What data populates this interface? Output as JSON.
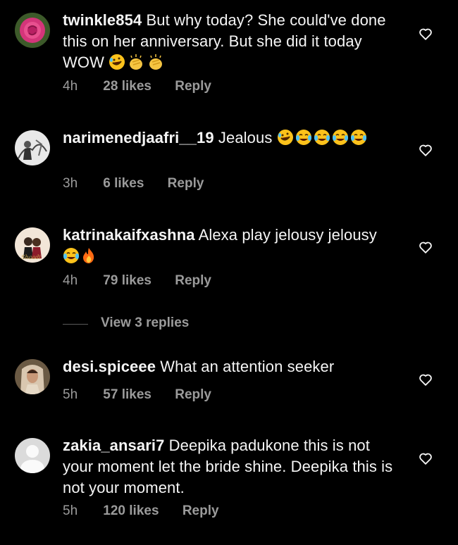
{
  "comments": [
    {
      "username": "twinkle854",
      "text": "But why today? She could've done this on her anniversary. But she did it today WOW",
      "emoji_names": [
        "rolling-on-floor-laughing-emoji",
        "clapping-hands-emoji",
        "clapping-hands-emoji"
      ],
      "time": "4h",
      "likes": "28 likes",
      "reply": "Reply",
      "avatar_icon": "pink-rose-avatar"
    },
    {
      "username": "narimenedjaafri__19",
      "text": "Jealous",
      "emoji_names": [
        "rolling-on-floor-laughing-emoji",
        "tears-of-joy-emoji",
        "tears-of-joy-emoji",
        "tears-of-joy-emoji",
        "tears-of-joy-emoji"
      ],
      "time": "3h",
      "likes": "6 likes",
      "reply": "Reply",
      "avatar_icon": "sketch-photo-avatar"
    },
    {
      "username": "katrinakaifxashna",
      "text": "Alexa play jelousy jelousy",
      "emoji_names": [
        "tears-of-joy-emoji",
        "fire-emoji"
      ],
      "time": "4h",
      "likes": "79 likes",
      "reply": "Reply",
      "avatar_icon": "couple-photo-avatar"
    },
    {
      "username": "desi.spiceee",
      "text": "What an attention seeker",
      "emoji_names": [],
      "time": "5h",
      "likes": "57 likes",
      "reply": "Reply",
      "avatar_icon": "bride-photo-avatar"
    },
    {
      "username": "zakia_ansari7",
      "text": "Deepika padukone this is not your moment let the bride shine. Deepika this is not your moment.",
      "emoji_names": [],
      "time": "5h",
      "likes": "120 likes",
      "reply": "Reply",
      "avatar_icon": "default-user-avatar"
    }
  ],
  "view_replies": "View 3 replies",
  "colors": {
    "background": "#000000",
    "text": "#f5f5f5",
    "secondary_text": "#9b9b9b",
    "divider": "#5a5a5a"
  }
}
